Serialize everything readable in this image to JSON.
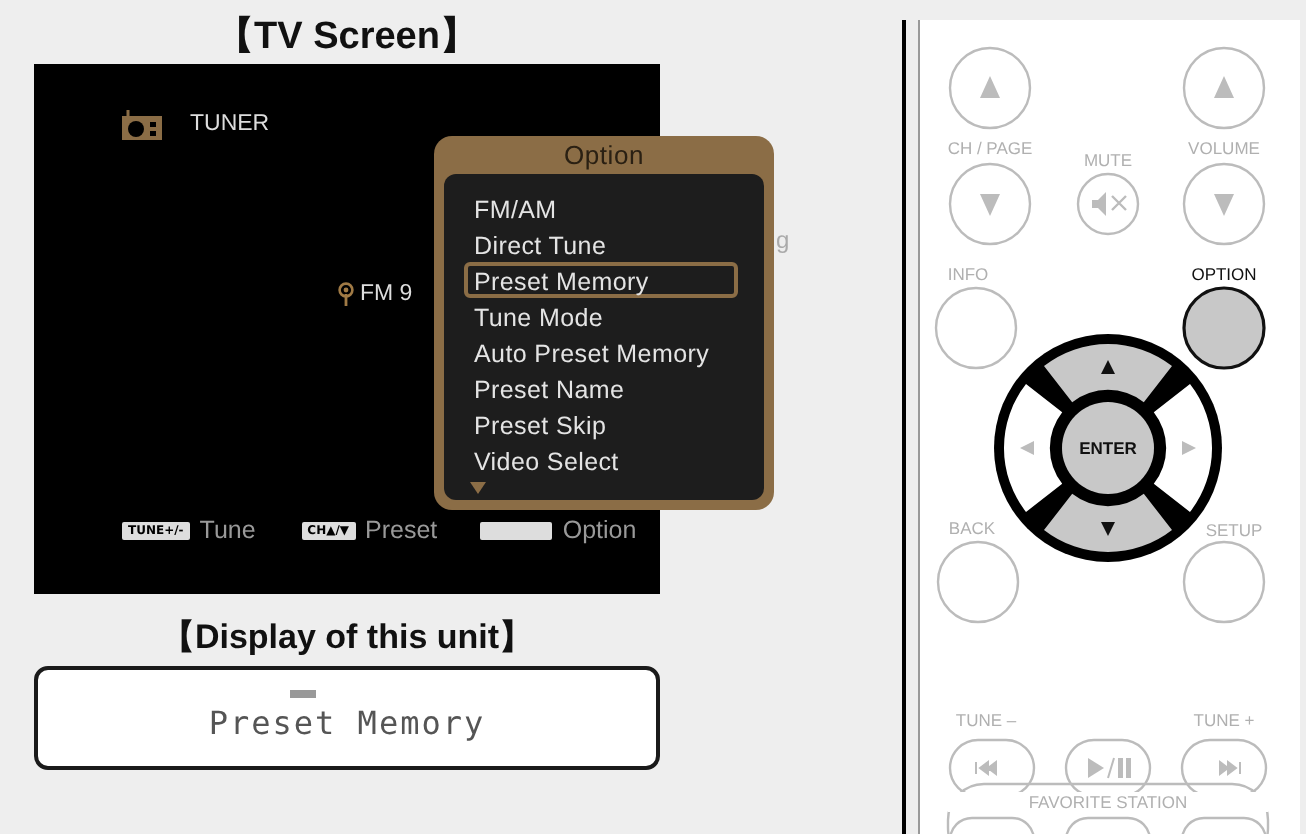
{
  "tv_screen": {
    "title": "【TV Screen】",
    "source": "TUNER",
    "frequency": "FM 9",
    "partial_text": "g",
    "hints": [
      {
        "key": "TUNE+/-",
        "label": "Tune"
      },
      {
        "key": "CH▲/▼",
        "label": "Preset"
      },
      {
        "label": "Option"
      }
    ],
    "option_menu": {
      "title": "Option",
      "more_below": true,
      "items": [
        {
          "label": "FM/AM",
          "selected": false
        },
        {
          "label": "Direct Tune",
          "selected": false
        },
        {
          "label": "Preset Memory",
          "selected": true
        },
        {
          "label": "Tune Mode",
          "selected": false
        },
        {
          "label": "Auto Preset Memory",
          "selected": false
        },
        {
          "label": "Preset Name",
          "selected": false
        },
        {
          "label": "Preset Skip",
          "selected": false
        },
        {
          "label": "Video Select",
          "selected": false
        }
      ]
    }
  },
  "unit_display": {
    "title": "【Display of this unit】",
    "text": "Preset Memory"
  },
  "remote": {
    "buttons": [
      {
        "highlighted": false
      },
      {
        "highlighted": false
      },
      {
        "caption": "CH / PAGE",
        "highlighted": false
      },
      {
        "caption": "MUTE",
        "highlighted": false
      },
      {
        "caption": "VOLUME",
        "highlighted": false
      },
      {
        "caption": "INFO",
        "highlighted": false
      },
      {
        "caption": "OPTION",
        "highlighted": true
      },
      {
        "caption": "BACK",
        "highlighted": false
      },
      {
        "caption": "SETUP",
        "highlighted": false
      },
      {
        "caption": "TUNE –",
        "highlighted": false
      },
      {
        "highlighted": false
      },
      {
        "caption": "TUNE +",
        "highlighted": false
      }
    ],
    "dial": {
      "center": "ENTER",
      "segments": [
        {
          "highlighted": true
        },
        {
          "highlighted": false
        },
        {
          "highlighted": true
        },
        {
          "highlighted": false
        }
      ]
    },
    "group_caption": "FAVORITE STATION"
  }
}
